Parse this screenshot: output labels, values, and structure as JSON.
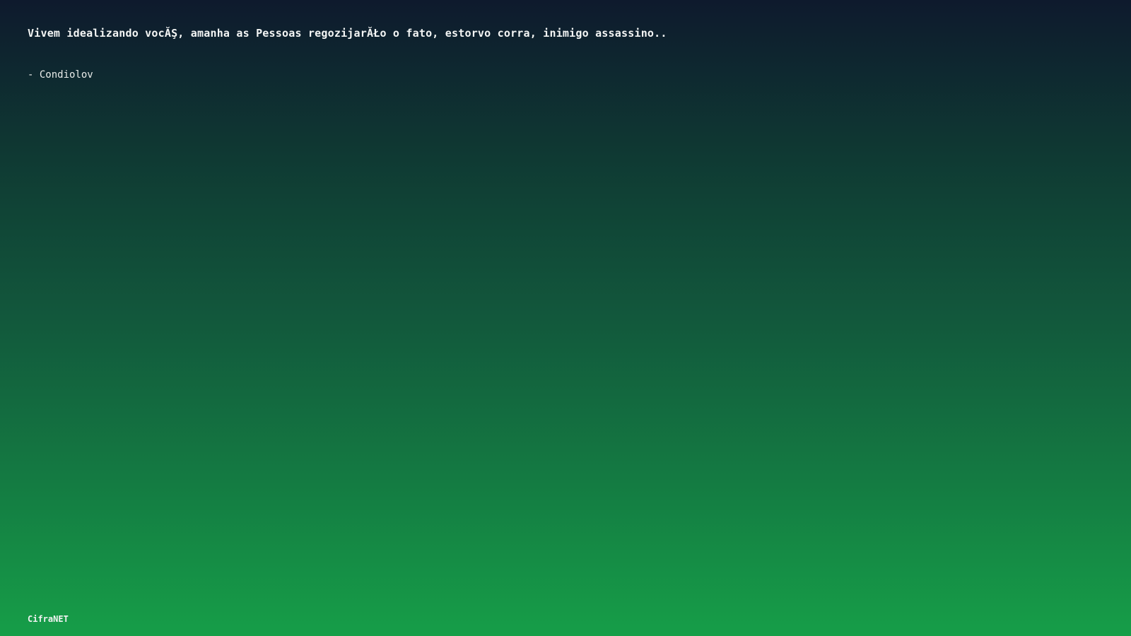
{
  "quote": {
    "text": "Vivem idealizando vocĂŞ, amanha as Pessoas regozijarĂŁo o fato, estorvo corra, inimigo assassino..",
    "author": "- Condiolov"
  },
  "footer": {
    "brand": "CifraNET"
  },
  "colors": {
    "gradient_top": "#0e1a2d",
    "gradient_bottom": "#169e48",
    "text": "#ffffff"
  }
}
